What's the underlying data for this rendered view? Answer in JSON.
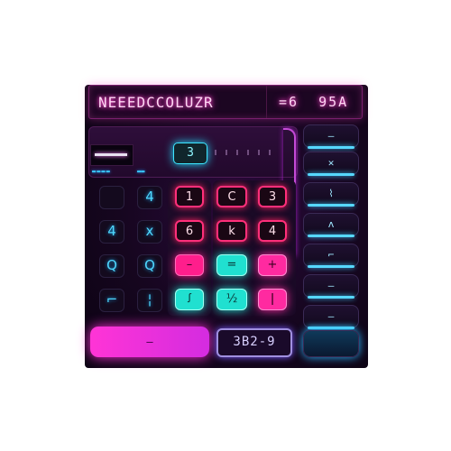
{
  "display": {
    "title": "NEEEDCCOLUZR",
    "value": "=6  95A"
  },
  "memory": {
    "value": "3"
  },
  "mini_label": "▬▬▬▬",
  "mini_label2": "▬▬",
  "keys": [
    {
      "id": "k1",
      "label": "",
      "style": "k-dark"
    },
    {
      "id": "k2",
      "label": "4",
      "style": "k-dark"
    },
    {
      "id": "k3",
      "label": "1",
      "style": "k-pink-out"
    },
    {
      "id": "k4",
      "label": "C",
      "style": "k-pink-out"
    },
    {
      "id": "k5",
      "label": "3",
      "style": "k-pink-out"
    },
    {
      "id": "k6",
      "label": "4",
      "style": "k-dark"
    },
    {
      "id": "k7",
      "label": "x",
      "style": "k-dark"
    },
    {
      "id": "k8",
      "label": "6",
      "style": "k-pink-out"
    },
    {
      "id": "k9",
      "label": "k",
      "style": "k-pink-out"
    },
    {
      "id": "k10",
      "label": "4",
      "style": "k-pink-out"
    },
    {
      "id": "k11",
      "label": "Q",
      "style": "k-dark"
    },
    {
      "id": "k12",
      "label": "Q",
      "style": "k-dark"
    },
    {
      "id": "k13",
      "label": "–",
      "style": "k-pink"
    },
    {
      "id": "k14",
      "label": "=",
      "style": "k-cyan"
    },
    {
      "id": "k15",
      "label": "+",
      "style": "k-magenta"
    },
    {
      "id": "k16",
      "label": "⌐",
      "style": "k-dark"
    },
    {
      "id": "k17",
      "label": "¦",
      "style": "k-dark"
    },
    {
      "id": "k18",
      "label": "ꭍ",
      "style": "k-cyan"
    },
    {
      "id": "k19",
      "label": "½",
      "style": "k-cyan"
    },
    {
      "id": "k20",
      "label": "ǀ",
      "style": "k-magenta"
    }
  ],
  "side_keys": [
    "—",
    "✕",
    "⌇",
    "ʌ",
    "⌐",
    "—",
    "—"
  ],
  "wide_key": {
    "label": "—"
  },
  "readout": {
    "value": "3B2-9"
  },
  "colors": {
    "accent_pink": "#ff1e8c",
    "accent_cyan": "#20e0d0",
    "accent_blue": "#4fd8ff",
    "accent_magenta": "#ff34d6"
  }
}
